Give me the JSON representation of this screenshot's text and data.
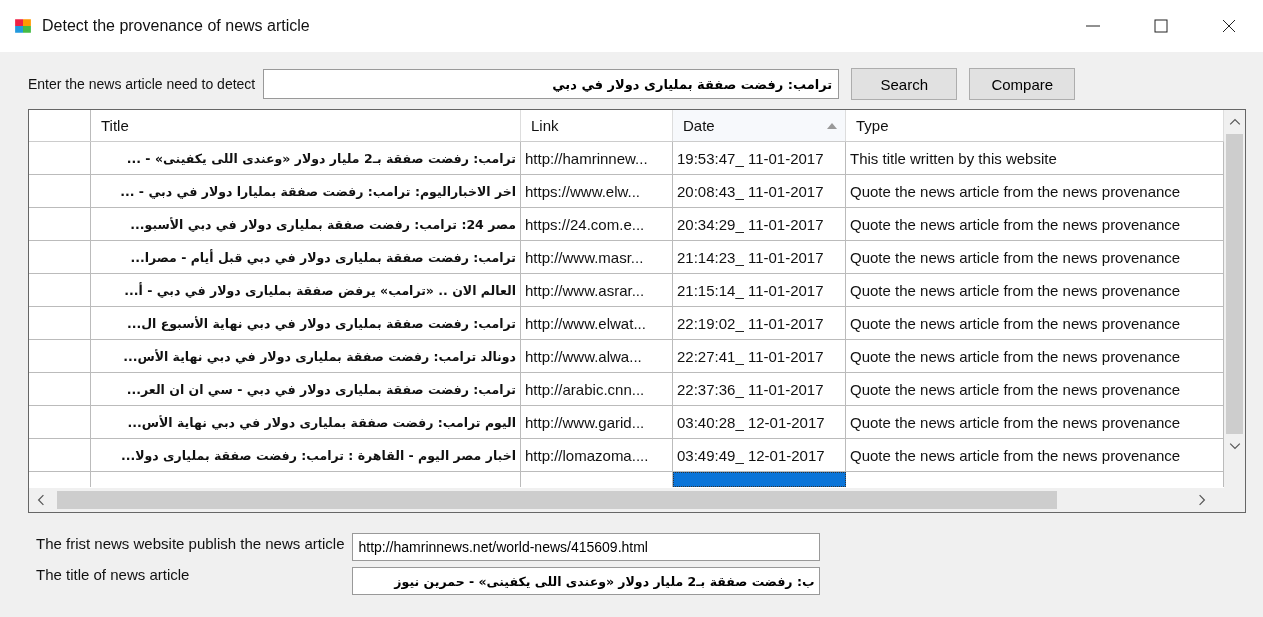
{
  "window": {
    "title": "Detect the provenance of news article"
  },
  "search": {
    "label": "Enter the news article need to detect",
    "value": "ترامب: رفضت صفقة بمليارى دولار في دبي",
    "buttons": [
      "Search",
      "Compare"
    ]
  },
  "table": {
    "columns": [
      {
        "label": "Title",
        "sorted": false
      },
      {
        "label": "Link",
        "sorted": false
      },
      {
        "label": "Date",
        "sorted": true
      },
      {
        "label": "Type",
        "sorted": false
      }
    ],
    "rows": [
      {
        "title": "ترامب: رفضت صفقة بـ2 مليار دولار «وعندى اللى يكفينى» - ...",
        "link": "http://hamrinnew...",
        "date": "19:53:47_ 11-01-2017",
        "type": "This title written by this website"
      },
      {
        "title": "اخر الاخباراليوم: ترامب: رفضت صفقة بمليارا دولار في دبي - ...",
        "link": "https://www.elw...",
        "date": "20:08:43_ 11-01-2017",
        "type": "Quote the news article from the news provenance"
      },
      {
        "title": "مصر 24: ترامب: رفضت صفقة بمليارى دولار في دبي الأسبو...",
        "link": "https://24.com.e...",
        "date": "20:34:29_ 11-01-2017",
        "type": "Quote the news article from the news provenance"
      },
      {
        "title": "ترامب: رفضت صفقة بمليارى دولار في دبي قبل أيام - مصرا...",
        "link": "http://www.masr...",
        "date": "21:14:23_ 11-01-2017",
        "type": "Quote the news article from the news provenance"
      },
      {
        "title": "العالم الان .. «ترامب» يرفض صفقة بمليارى دولار في دبي - أ...",
        "link": "http://www.asrar...",
        "date": "21:15:14_ 11-01-2017",
        "type": "Quote the news article from the news provenance"
      },
      {
        "title": "ترامب: رفضت صفقة بمليارى دولار في دبي نهاية الأسبوع ال...",
        "link": "http://www.elwat...",
        "date": "22:19:02_ 11-01-2017",
        "type": "Quote the news article from the news provenance"
      },
      {
        "title": "دونالد ترامب: رفضت صفقة بمليارى دولار في دبي نهاية الأس...",
        "link": "http://www.alwa...",
        "date": "22:27:41_ 11-01-2017",
        "type": "Quote the news article from the news provenance"
      },
      {
        "title": "ترامب: رفضت صفقة بمليارى دولار في دبي - سي ان ان العر...",
        "link": "http://arabic.cnn...",
        "date": "22:37:36_ 11-01-2017",
        "type": "Quote the news article from the news provenance"
      },
      {
        "title": "اليوم ترامب: رفضت صفقة بمليارى دولار في دبي نهاية الأس...",
        "link": "http://www.garid...",
        "date": "03:40:28_ 12-01-2017",
        "type": "Quote the news article from the news provenance"
      },
      {
        "title": "اخبار مصر اليوم - القاهرة : ترامب: رفضت صفقة بمليارى دولا...",
        "link": "http://lomazoma....",
        "date": "03:49:49_ 12-01-2017",
        "type": "Quote the news article from the news provenance"
      }
    ],
    "new_row": {
      "date_selected": true
    }
  },
  "result": {
    "first_label": "The frist news website publish the news article",
    "first_value": "http://hamrinnews.net/world-news/415609.html",
    "title_label": "The title of news article",
    "title_value": "ب: رفضت صفقة بـ2 مليار دولار «وعندى اللى يكفينى» - حمرين نيوز"
  }
}
